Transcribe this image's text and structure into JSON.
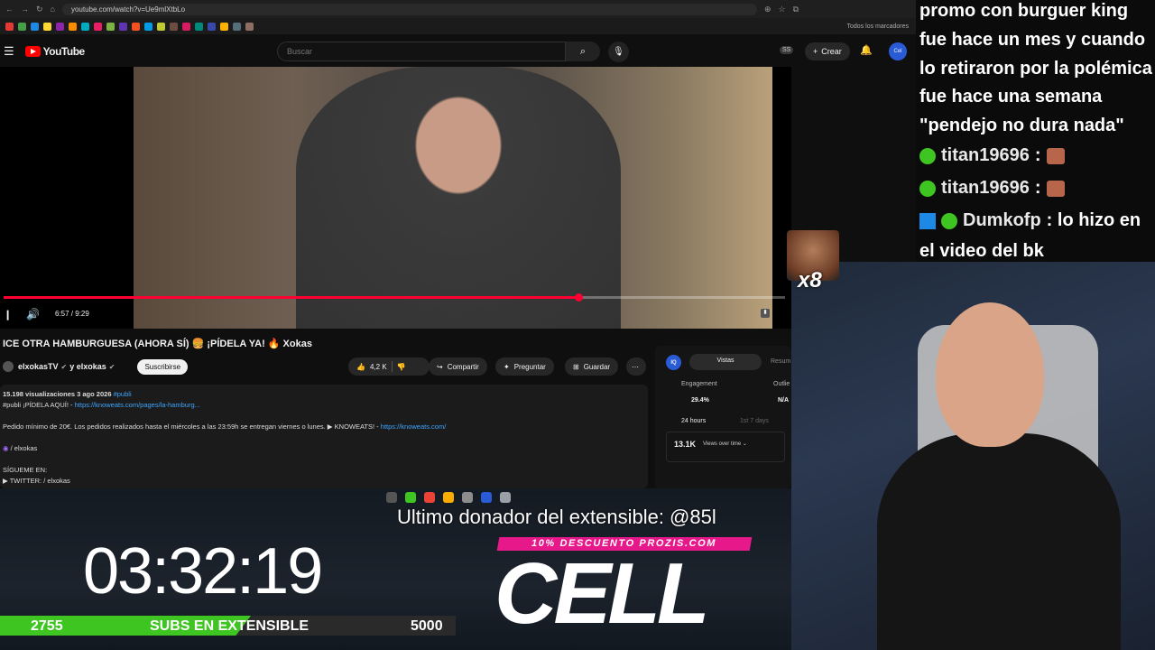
{
  "browser": {
    "url": "youtube.com/watch?v=Ue9mlXtbLo",
    "bookmarks_folder": "Todos los marcadores",
    "bookmark_colors": [
      "#e53935",
      "#43a047",
      "#1e88e5",
      "#fdd835",
      "#8e24aa",
      "#fb8c00",
      "#00acc1",
      "#e91e63",
      "#7cb342",
      "#5e35b1",
      "#f4511e",
      "#039be5",
      "#c0ca33",
      "#6d4c41",
      "#d81b60",
      "#00897b",
      "#3949ab",
      "#ffb300",
      "#546e7a",
      "#8d6e63"
    ]
  },
  "youtube": {
    "logo": "YouTube",
    "search_placeholder": "Buscar",
    "ss_badge": "SS",
    "create_label": "Crear",
    "avatar_text": "Cel"
  },
  "player": {
    "time": "6:57 / 9:29",
    "progress": 0.735
  },
  "video": {
    "title": "ICE OTRA HAMBURGUESA (AHORA SÍ) 🍔 ¡PÍDELA YA! 🔥 Xokas",
    "channel": "elxokasTV",
    "channel_joint": "y elxokas",
    "subscribe": "Suscribirse",
    "likes": "4,2 K",
    "share": "Compartir",
    "ask": "Preguntar",
    "save": "Guardar"
  },
  "description": {
    "stats": "15.198 visualizaciones  3 ago 2026",
    "hashtag": "#publi",
    "line1_prefix": "#publi ¡PÍDELA AQUÍ! - ",
    "line1_link": "https://knoweats.com/pages/la-hamburg...",
    "line2_text": "Pedido mínimo de 20€. Los pedidos realizados hasta el miércoles a las 23:59h se entregan viernes o lunes. ▶ KNOWEATS! - ",
    "line2_link": "https://knoweats.com/",
    "line3": "/ elxokas",
    "line4": "SÍGUEME EN:",
    "line5": "▶ TWITTER:   / elxokas"
  },
  "analytics": {
    "logo": "IQ",
    "tab_active": "Vistas",
    "tab_other": "Resum",
    "engagement_label": "Engagement",
    "engagement_value": "29.4%",
    "outlier_label": "Outlie",
    "outlier_value": "N/A",
    "range_active": "24 hours",
    "range_other": "1st 7 days",
    "views": "13.1K",
    "views_sub": "Views over time ⌄"
  },
  "taskbar_colors": [
    "#555555",
    "#3fc521",
    "#ea4335",
    "#f9ab00",
    "#8d8d8d",
    "#2a5bd7",
    "#9aa0a6"
  ],
  "overlay": {
    "donor": "Ultimo donador del extensible: @85l",
    "timer": "03:32:19",
    "promo": "10% DESCUENTO PROZIS.COM",
    "brand": "CELL",
    "goal_current": "2755",
    "goal_label": "SUBS EN EXTENSIBLE",
    "goal_target": "5000",
    "goal_fraction": 0.551
  },
  "emote_multiplier": "x8",
  "chat": {
    "message_lines": [
      "promo con burguer king",
      "fue hace un mes y cuando",
      "lo retiraron por la polémica",
      "fue hace una semana",
      "\"pendejo no dura nada\""
    ],
    "messages": [
      {
        "user": "titan19696",
        "text": ":"
      },
      {
        "user": "titan19696",
        "text": ":"
      },
      {
        "user": "Dumkofp",
        "text": ": lo hizo en"
      }
    ],
    "last_line": "el video del bk"
  }
}
